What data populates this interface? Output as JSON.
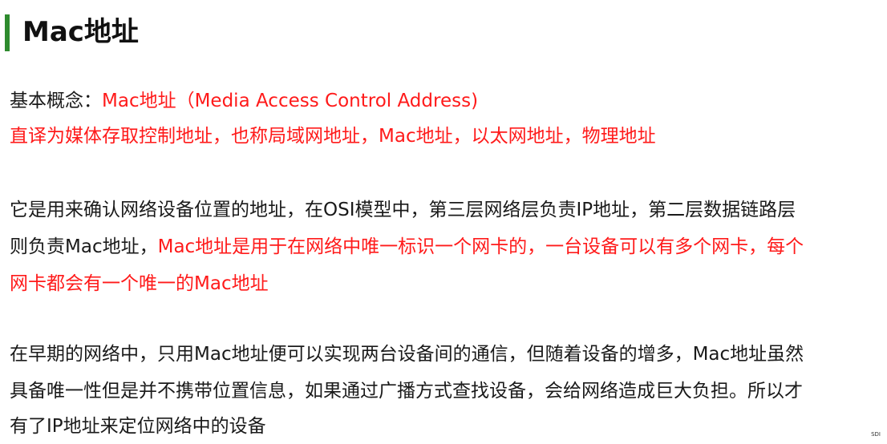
{
  "title": "Mac地址",
  "section1": {
    "label": "基本概念：",
    "term": "Mac地址（Media Access Control Address)",
    "line2": "直译为媒体存取控制地址，也称局域网地址，Mac地址，以太网地址，物理地址"
  },
  "section2": {
    "line1": "它是用来确认网络设备位置的地址，在OSI模型中，第三层网络层负责IP地址，第二层数据链路层",
    "line2_black": "则负责Mac地址，",
    "line2_red": "Mac地址是用于在网络中唯一标识一个网卡的，一台设备可以有多个网卡，每个",
    "line3_red": "网卡都会有一个唯一的Mac地址"
  },
  "section3": {
    "line1": "在早期的网络中，只用Mac地址便可以实现两台设备间的通信，但随着设备的增多，Mac地址虽然",
    "line2": "具备唯一性但是并不携带位置信息，如果通过广播方式查找设备，会给网络造成巨大负担。所以才",
    "line3": "有了IP地址来定位网络中的设备"
  },
  "footer": {
    "slide_mark": "SDI"
  },
  "colors": {
    "accent_bar": "#2e8b2e",
    "highlight": "#ff1a1a",
    "text": "#1a1a1a"
  }
}
